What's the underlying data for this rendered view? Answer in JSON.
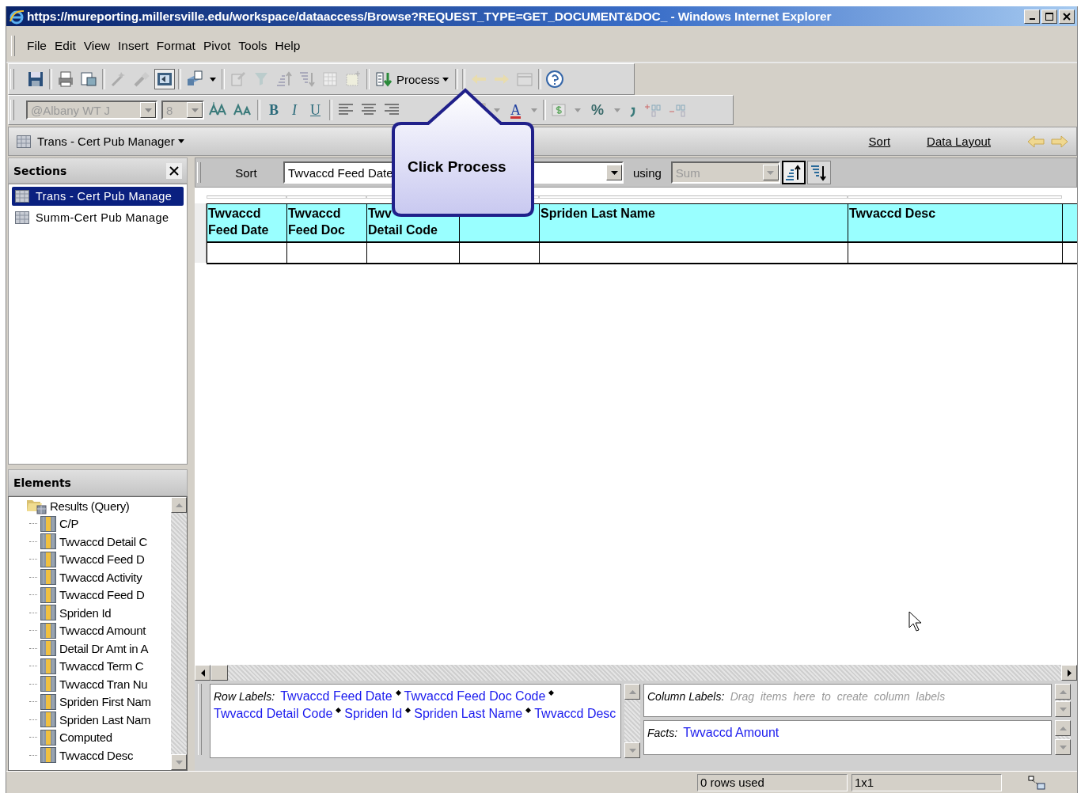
{
  "window": {
    "title": "https://mureporting.millersville.edu/workspace/dataaccess/Browse?REQUEST_TYPE=GET_DOCUMENT&DOC_ - Windows Internet Explorer"
  },
  "menu": [
    "File",
    "Edit",
    "View",
    "Insert",
    "Format",
    "Pivot",
    "Tools",
    "Help"
  ],
  "toolbar": {
    "process_button": "Process"
  },
  "format_toolbar": {
    "font": {
      "value": "@Albany WT J",
      "disabled": true
    },
    "size": {
      "value": "8",
      "disabled": true
    },
    "bold": "B",
    "italic": "I",
    "underline": "U",
    "font_color": "A",
    "percent": "%"
  },
  "section_bar": {
    "title": "Trans - Cert Pub Manager",
    "links": [
      "Sort",
      "Data Layout"
    ]
  },
  "sections_panel": {
    "title": "Sections",
    "items": [
      {
        "label": "Trans - Cert Pub Manage",
        "selected": true
      },
      {
        "label": "Summ-Cert Pub Manage",
        "selected": false
      }
    ]
  },
  "elements_panel": {
    "title": "Elements",
    "tree": [
      {
        "label": "Results (Query)",
        "expanded": true,
        "children": [
          {
            "label": "C/P"
          },
          {
            "label": "Twvaccd Detail C"
          },
          {
            "label": "Twvaccd Feed D"
          },
          {
            "label": "Twvaccd Activity"
          },
          {
            "label": "Twvaccd Feed D"
          },
          {
            "label": "Spriden Id"
          },
          {
            "label": "Twvaccd Amount"
          },
          {
            "label": "Detail Dr Amt in A"
          },
          {
            "label": "Twvaccd Term C"
          },
          {
            "label": "Twvaccd Tran Nu"
          },
          {
            "label": "Spriden First Nam"
          },
          {
            "label": "Spriden Last Nam"
          },
          {
            "label": "Computed"
          },
          {
            "label": "Twvaccd Desc"
          }
        ]
      }
    ]
  },
  "sort_bar": {
    "label": "Sort",
    "field": "Twvaccd Feed Date",
    "using_label": "using",
    "using_field": {
      "value": "Sum",
      "disabled": true
    },
    "order_buttons": [
      {
        "kind": "ascending",
        "selected": true
      },
      {
        "kind": "descending",
        "selected": false
      }
    ]
  },
  "table": {
    "columns": [
      {
        "kind": "text",
        "lines": [
          "Twvaccd",
          "Feed Date"
        ]
      },
      {
        "kind": "text",
        "lines": [
          "Twvaccd",
          "Feed Doc"
        ]
      },
      {
        "kind": "text",
        "lines": [
          "Twv",
          "Detail Code"
        ]
      },
      {
        "kind": "blank"
      },
      {
        "kind": "text",
        "lines": [
          "Spriden Last Name"
        ]
      },
      {
        "kind": "text",
        "lines": [
          "Twvaccd Desc"
        ]
      }
    ]
  },
  "callout": {
    "text": "Click Process"
  },
  "row_labels": {
    "label": "Row Labels:",
    "items": [
      "Twvaccd Feed Date",
      "Twvaccd Feed Doc Code",
      "Twvaccd Detail Code",
      "Spriden Id",
      "Spriden Last Name",
      "Twvaccd Desc"
    ]
  },
  "column_labels": {
    "label": "Column Labels:",
    "placeholder": "Drag items here to create column labels"
  },
  "facts": {
    "label": "Facts:",
    "items": [
      "Twvaccd Amount"
    ]
  },
  "status_bar": {
    "rows": "0 rows used",
    "size": "1x1"
  }
}
